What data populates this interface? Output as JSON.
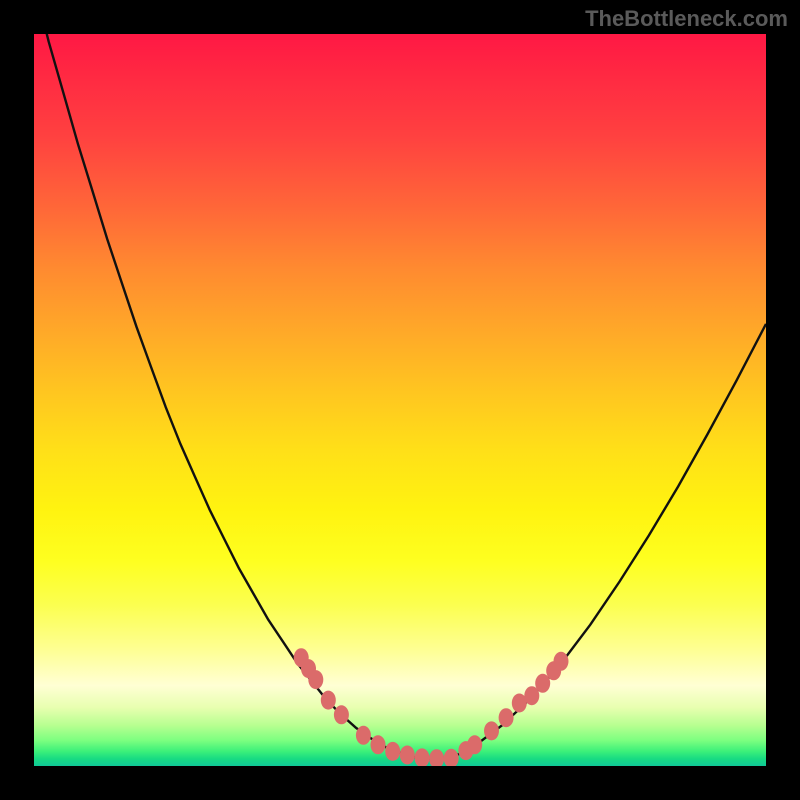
{
  "watermark": "TheBottleneck.com",
  "chart_data": {
    "type": "line",
    "title": "",
    "xlabel": "",
    "ylabel": "",
    "xlim": [
      0,
      100
    ],
    "ylim": [
      0,
      100
    ],
    "series": [
      {
        "name": "bottleneck-curve",
        "x": [
          0,
          2,
          4,
          6,
          8,
          10,
          12,
          14,
          16,
          18,
          20,
          22,
          24,
          26,
          28,
          30,
          32,
          34,
          36,
          38,
          40,
          42,
          44,
          46,
          48,
          50,
          52,
          54,
          56,
          58,
          60,
          64,
          68,
          72,
          76,
          80,
          84,
          88,
          92,
          96,
          100
        ],
        "y": [
          107,
          99,
          92,
          85,
          78.5,
          72,
          66,
          60,
          54.5,
          49,
          44,
          39.5,
          35,
          31,
          27,
          23.5,
          20,
          17,
          14,
          11.5,
          9,
          7,
          5.2,
          3.8,
          2.6,
          1.8,
          1.2,
          1.0,
          1.1,
          1.6,
          2.6,
          5.6,
          9.4,
          14.0,
          19.3,
          25.2,
          31.5,
          38.2,
          45.3,
          52.7,
          60.4
        ]
      }
    ],
    "markers": {
      "name": "highlight-dots",
      "x": [
        36.5,
        37.5,
        38.5,
        40.2,
        42.0,
        45.0,
        47.0,
        49.0,
        51.0,
        53.0,
        55.0,
        57.0,
        59.0,
        60.2,
        62.5,
        64.5,
        66.3,
        68.0,
        69.5,
        71.0,
        72.0
      ],
      "y": [
        14.8,
        13.3,
        11.8,
        9.0,
        7.0,
        4.2,
        2.9,
        2.0,
        1.5,
        1.1,
        1.0,
        1.05,
        2.1,
        2.9,
        4.8,
        6.6,
        8.6,
        9.6,
        11.3,
        13.0,
        14.3
      ]
    },
    "colors": {
      "curve": "#111111",
      "markers": "#db6b6a",
      "gradient_top": "#ff1844",
      "gradient_bottom": "#10c998"
    }
  }
}
